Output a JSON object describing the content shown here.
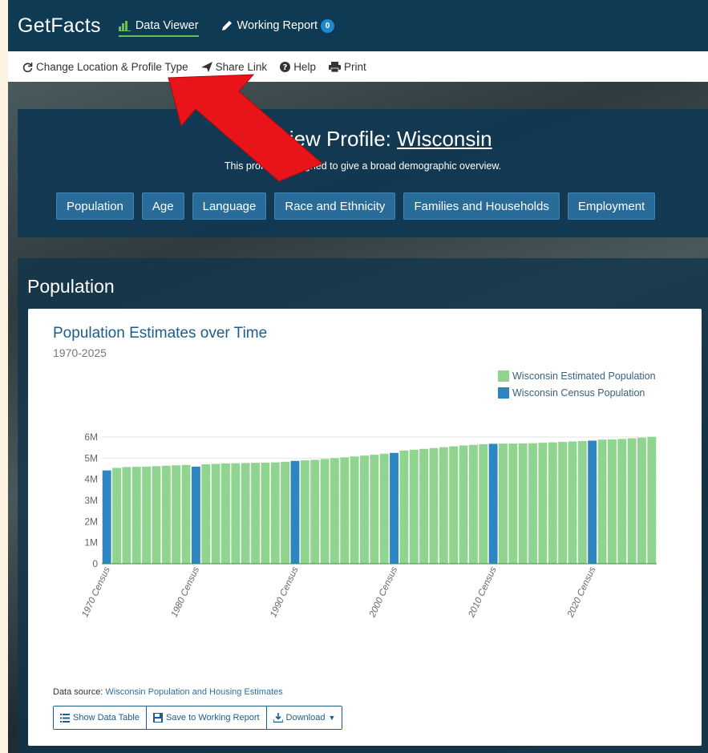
{
  "nav": {
    "brand": "GetFacts",
    "data_viewer": "Data Viewer",
    "working_report": "Working Report",
    "report_count": "0"
  },
  "util": {
    "change_location": "Change Location & Profile Type",
    "share_link": "Share Link",
    "help": "Help",
    "print": "Print"
  },
  "overview": {
    "title_prefix": "Overview Profile: ",
    "location": "Wisconsin",
    "subtitle": "This profile is designed to give a broad demographic overview.",
    "tabs": [
      "Population",
      "Age",
      "Language",
      "Race and Ethnicity",
      "Families and Households",
      "Employment"
    ]
  },
  "population": {
    "section_title": "Population",
    "chart_title": "Population Estimates over Time",
    "chart_subtitle": "1970-2025",
    "data_source_label": "Data source: ",
    "data_source_link": "Wisconsin Population and Housing Estimates",
    "buttons": {
      "show_table": "Show Data Table",
      "save": "Save to Working Report",
      "download": "Download"
    }
  },
  "colors": {
    "estimated": "#8fd58f",
    "census": "#2e86c1",
    "nav_bg": "#0e3a54",
    "arrow": "#e8141a"
  },
  "chart_data": {
    "type": "bar",
    "title": "Population Estimates over Time",
    "subtitle": "1970-2025",
    "series": [
      {
        "name": "Wisconsin Estimated Population",
        "color": "#8fd58f"
      },
      {
        "name": "Wisconsin Census Population",
        "color": "#2e86c1"
      }
    ],
    "ylim": [
      0,
      6000000
    ],
    "yticks": [
      "0",
      "1M",
      "2M",
      "3M",
      "4M",
      "5M",
      "6M"
    ],
    "ytick_values": [
      0,
      1000000,
      2000000,
      3000000,
      4000000,
      5000000,
      6000000
    ],
    "xtick_labels": [
      "1970 Census",
      "1980 Census",
      "1990 Census",
      "2000 Census",
      "2010 Census",
      "2020 Census"
    ],
    "xtick_indices": [
      0,
      9,
      19,
      29,
      39,
      49
    ],
    "census_indices": [
      0,
      9,
      19,
      29,
      39,
      49
    ],
    "values": [
      4420000,
      4540000,
      4580000,
      4590000,
      4600000,
      4620000,
      4640000,
      4660000,
      4680000,
      4600000,
      4710000,
      4730000,
      4750000,
      4760000,
      4770000,
      4780000,
      4790000,
      4800000,
      4830000,
      4870000,
      4900000,
      4920000,
      4960000,
      5000000,
      5040000,
      5080000,
      5120000,
      5160000,
      5210000,
      5250000,
      5360000,
      5400000,
      5440000,
      5480000,
      5520000,
      5560000,
      5600000,
      5630000,
      5660000,
      5680000,
      5690000,
      5690000,
      5700000,
      5710000,
      5730000,
      5750000,
      5770000,
      5790000,
      5810000,
      5830000,
      5880000,
      5890000,
      5910000,
      5940000,
      5970000,
      6010000
    ]
  }
}
